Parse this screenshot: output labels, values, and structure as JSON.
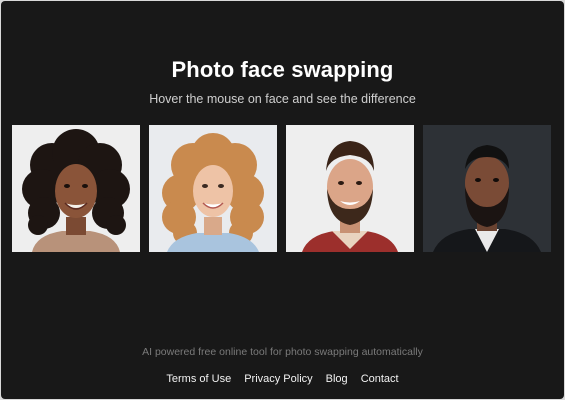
{
  "header": {
    "title": "Photo face swapping",
    "subtitle": "Hover the mouse on face and see the difference"
  },
  "faces": [
    {
      "name": "face-photo-1",
      "icon": "portrait-woman-curly-dark-hair-icon",
      "bg": "#eeeeee"
    },
    {
      "name": "face-photo-2",
      "icon": "portrait-woman-curly-blonde-hair-icon",
      "bg": "#e9ebee"
    },
    {
      "name": "face-photo-3",
      "icon": "portrait-man-beard-smiling-icon",
      "bg": "#eeeeee"
    },
    {
      "name": "face-photo-4",
      "icon": "portrait-man-beard-dark-bg-icon",
      "bg": "#2d3136"
    }
  ],
  "footer": {
    "tagline": "AI powered free online tool for photo swapping automatically",
    "links": [
      "Terms of Use",
      "Privacy Policy",
      "Blog",
      "Contact"
    ]
  },
  "colors": {
    "background": "#181818",
    "title": "#ffffff",
    "subtitle": "#cfcfcf",
    "tagline": "#7a7a7a",
    "link": "#f2f2f2"
  }
}
